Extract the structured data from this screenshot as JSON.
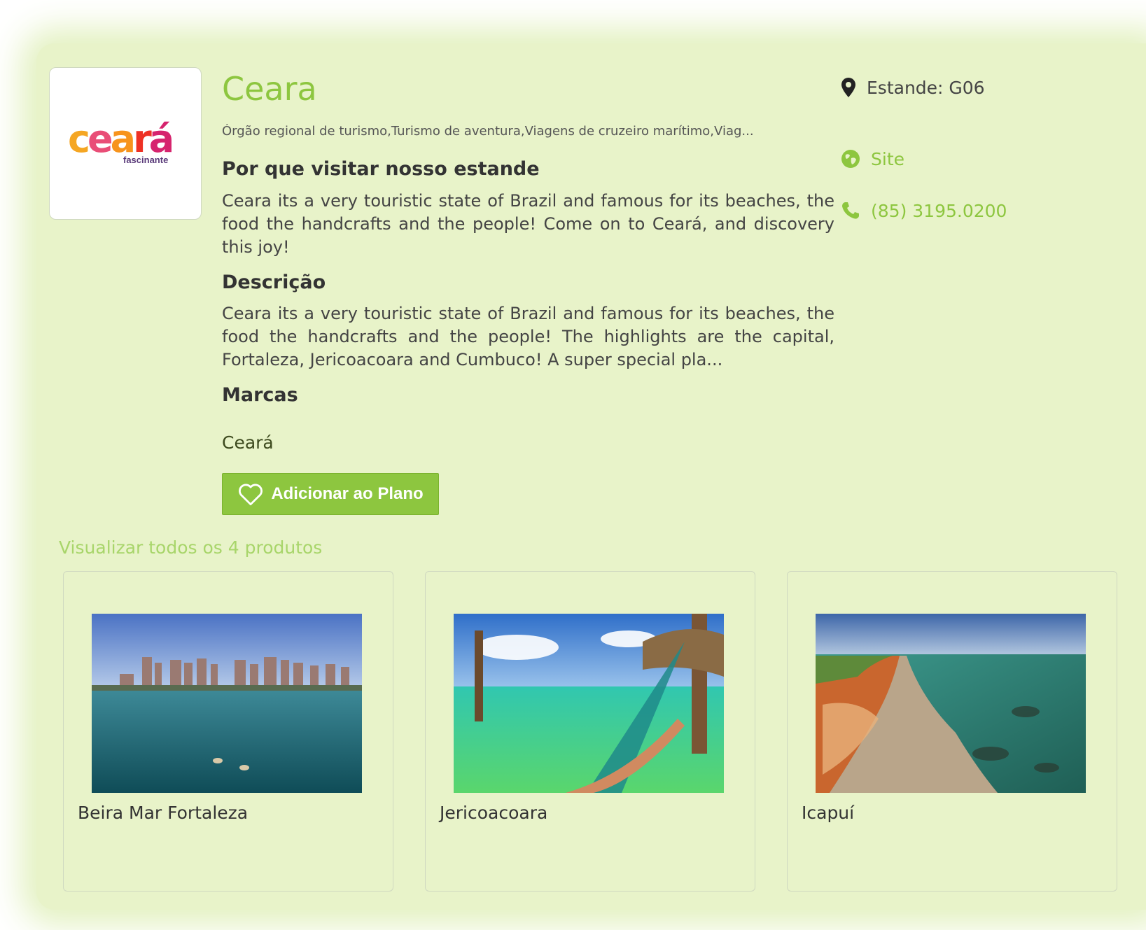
{
  "exhibitor": {
    "name": "Ceara",
    "logo": {
      "main_letters": [
        "c",
        "e",
        "a",
        "r",
        "á"
      ],
      "sub_text": "fascinante"
    },
    "categories": "Órgão regional de turismo,Turismo de aventura,Viagens de cruzeiro marítimo,Viag...",
    "why_visit": {
      "heading": "Por que visitar nosso estande",
      "text": "Ceara its a very touristic state of Brazil and famous for its beaches, the food the handcrafts and the people! Come on to Ceará, and discovery this joy!"
    },
    "description": {
      "heading": "Descrição",
      "text": "Ceara its a very touristic state of Brazil and famous for its beaches, the food the handcrafts and the people! The highlights are the capital, Fortaleza, Jericoacoara and Cumbuco! A super special pla..."
    },
    "brands": {
      "heading": "Marcas",
      "value": "Ceará"
    },
    "add_to_plan_label": "Adicionar ao Plano"
  },
  "sidebar": {
    "booth": {
      "icon": "map-pin-icon",
      "label": "Estande: G06"
    },
    "site": {
      "icon": "globe-icon",
      "label": "Site"
    },
    "phone": {
      "icon": "phone-icon",
      "label": "(85) 3195.0200"
    }
  },
  "products": {
    "view_all_label": "Visualizar todos os 4 produtos",
    "items": [
      {
        "name": "Beira Mar Fortaleza"
      },
      {
        "name": "Jericoacoara"
      },
      {
        "name": "Icapuí"
      }
    ]
  },
  "colors": {
    "accent": "#8dc63f",
    "panel_bg": "#e8f3c9",
    "link_light": "#a8d56a",
    "text_dark": "#333333"
  }
}
